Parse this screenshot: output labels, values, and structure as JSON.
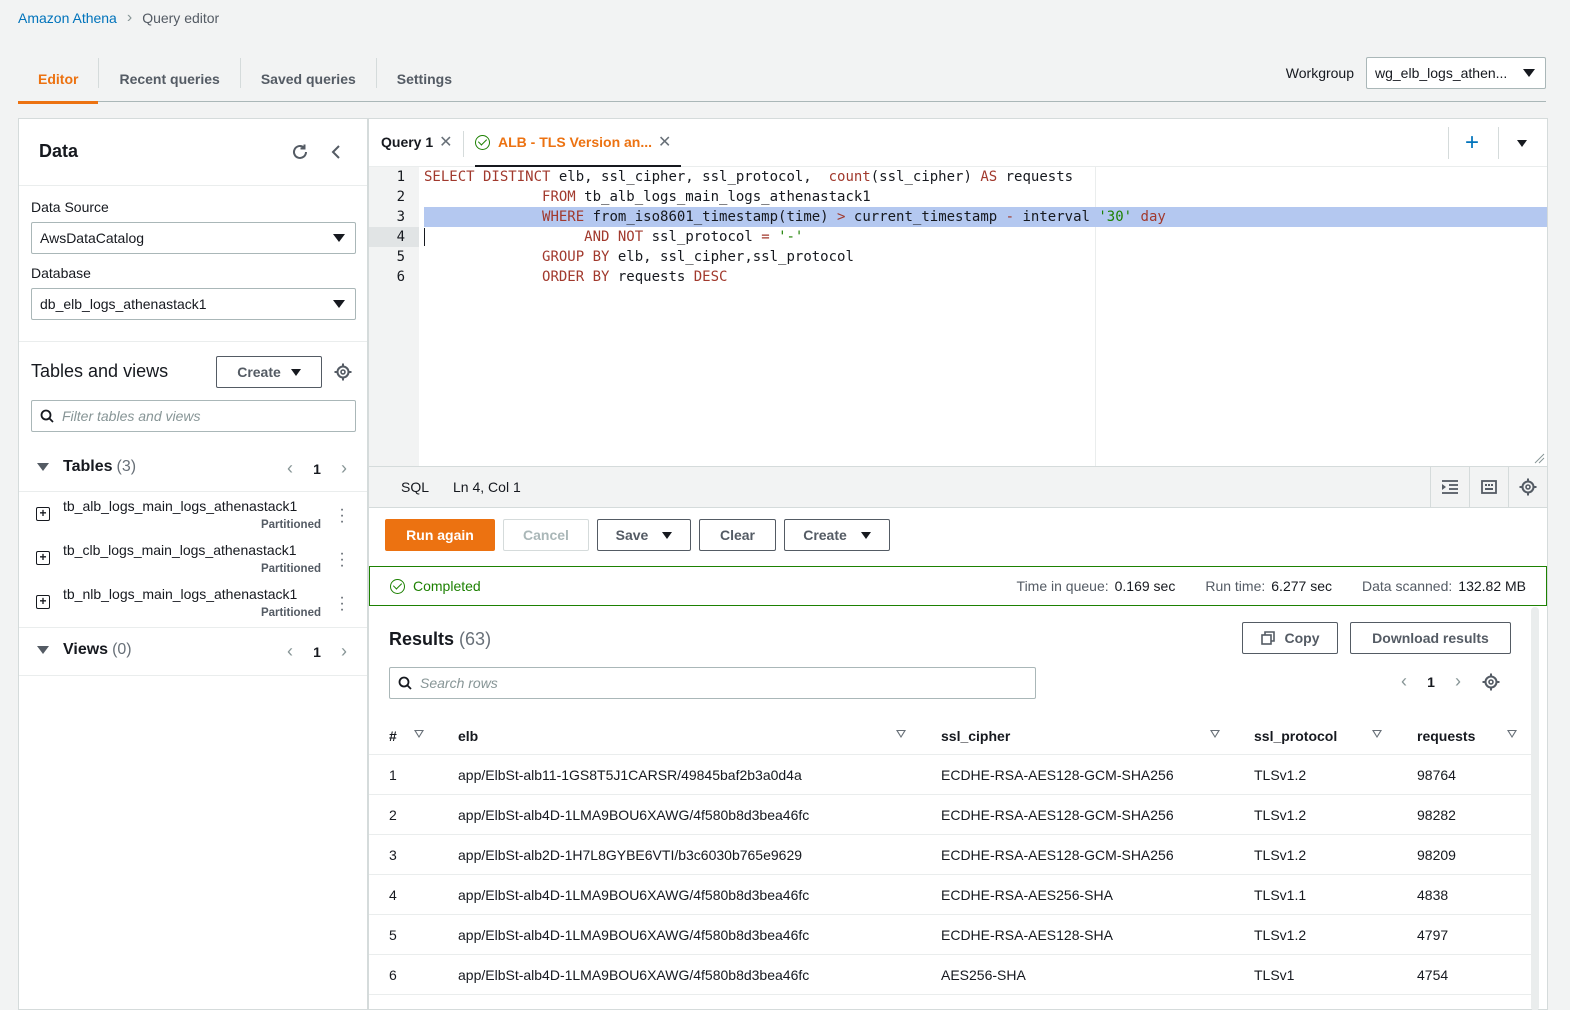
{
  "breadcrumb": {
    "root": "Amazon Athena",
    "current": "Query editor"
  },
  "main_tabs": [
    "Editor",
    "Recent queries",
    "Saved queries",
    "Settings"
  ],
  "workgroup": {
    "label": "Workgroup",
    "value": "wg_elb_logs_athen..."
  },
  "data_panel": {
    "title": "Data",
    "data_source_label": "Data Source",
    "data_source_value": "AwsDataCatalog",
    "database_label": "Database",
    "database_value": "db_elb_logs_athenastack1",
    "tables_views_title": "Tables and views",
    "create_label": "Create",
    "filter_placeholder": "Filter tables and views",
    "tables_label": "Tables",
    "tables_count": "(3)",
    "tables_page": "1",
    "tables": [
      {
        "name": "tb_alb_logs_main_logs_athenastack1",
        "tag": "Partitioned"
      },
      {
        "name": "tb_clb_logs_main_logs_athenastack1",
        "tag": "Partitioned"
      },
      {
        "name": "tb_nlb_logs_main_logs_athenastack1",
        "tag": "Partitioned"
      }
    ],
    "views_label": "Views",
    "views_count": "(0)",
    "views_page": "1"
  },
  "query_tabs": [
    {
      "label": "Query 1"
    },
    {
      "label": "ALB - TLS Version an..."
    }
  ],
  "editor": {
    "line_numbers": [
      "1",
      "2",
      "3",
      "4",
      "5",
      "6"
    ],
    "language": "SQL",
    "cursor": "Ln 4, Col 1"
  },
  "actions": {
    "run": "Run again",
    "cancel": "Cancel",
    "save": "Save",
    "clear": "Clear",
    "create": "Create"
  },
  "status": {
    "state": "Completed",
    "queue_label": "Time in queue:",
    "queue_value": "0.169 sec",
    "run_label": "Run time:",
    "run_value": "6.277 sec",
    "scanned_label": "Data scanned:",
    "scanned_value": "132.82 MB"
  },
  "results": {
    "title": "Results",
    "count": "(63)",
    "copy_label": "Copy",
    "download_label": "Download results",
    "search_placeholder": "Search rows",
    "page": "1",
    "columns": [
      "#",
      "elb",
      "ssl_cipher",
      "ssl_protocol",
      "requests"
    ],
    "rows": [
      [
        "1",
        "app/ElbSt-alb11-1GS8T5J1CARSR/49845baf2b3a0d4a",
        "ECDHE-RSA-AES128-GCM-SHA256",
        "TLSv1.2",
        "98764"
      ],
      [
        "2",
        "app/ElbSt-alb4D-1LMA9BOU6XAWG/4f580b8d3bea46fc",
        "ECDHE-RSA-AES128-GCM-SHA256",
        "TLSv1.2",
        "98282"
      ],
      [
        "3",
        "app/ElbSt-alb2D-1H7L8GYBE6VTI/b3c6030b765e9629",
        "ECDHE-RSA-AES128-GCM-SHA256",
        "TLSv1.2",
        "98209"
      ],
      [
        "4",
        "app/ElbSt-alb4D-1LMA9BOU6XAWG/4f580b8d3bea46fc",
        "ECDHE-RSA-AES256-SHA",
        "TLSv1.1",
        "4838"
      ],
      [
        "5",
        "app/ElbSt-alb4D-1LMA9BOU6XAWG/4f580b8d3bea46fc",
        "ECDHE-RSA-AES128-SHA",
        "TLSv1.2",
        "4797"
      ],
      [
        "6",
        "app/ElbSt-alb4D-1LMA9BOU6XAWG/4f580b8d3bea46fc",
        "AES256-SHA",
        "TLSv1",
        "4754"
      ]
    ]
  },
  "colors": {
    "accent": "#ec7211",
    "link": "#0073bb",
    "success": "#1d8102",
    "highlight": "#b4c8f0"
  }
}
